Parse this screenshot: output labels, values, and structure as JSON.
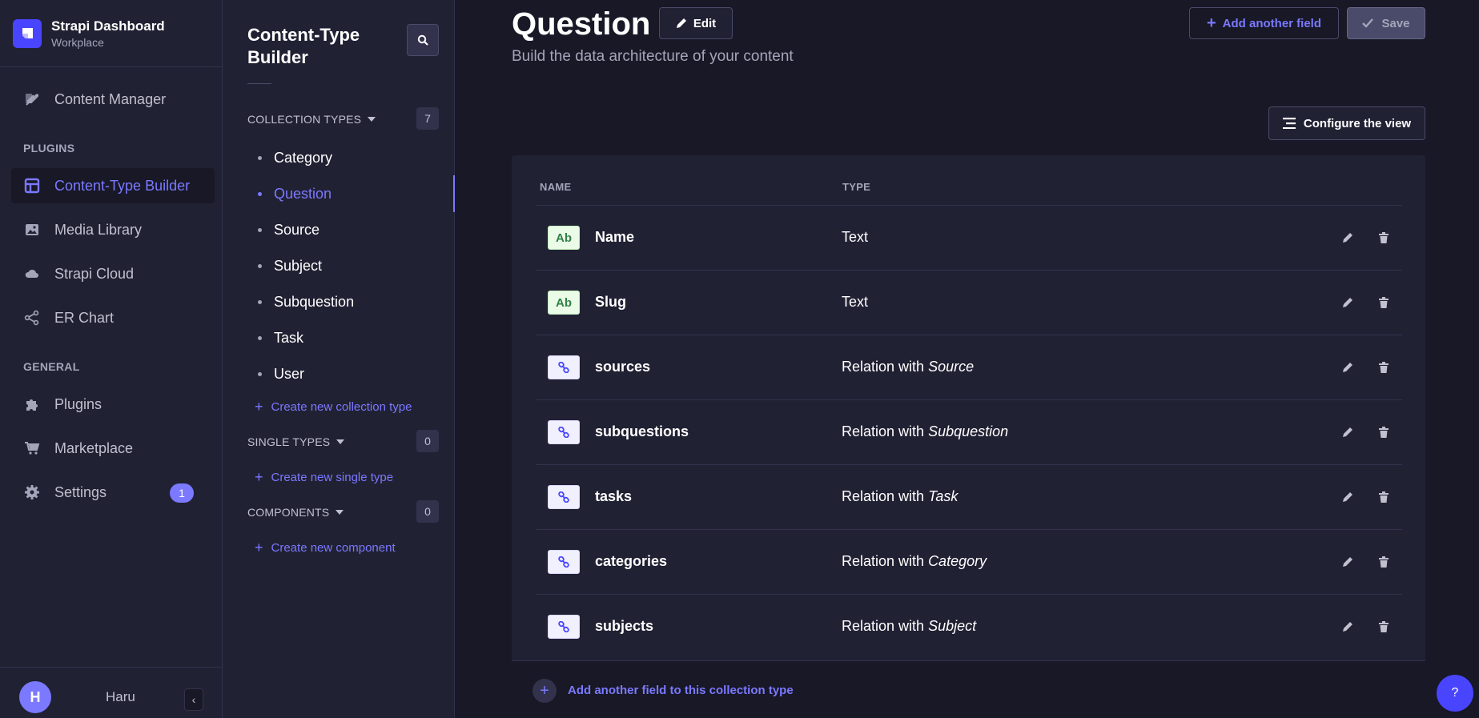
{
  "brand": {
    "title": "Strapi Dashboard",
    "subtitle": "Workplace"
  },
  "mainnav": {
    "items": [
      {
        "label": "Content Manager",
        "icon": "feather-icon"
      },
      {
        "label": "Content-Type Builder",
        "icon": "layout-icon",
        "active": true
      },
      {
        "label": "Media Library",
        "icon": "image-icon"
      },
      {
        "label": "Strapi Cloud",
        "icon": "cloud-icon"
      },
      {
        "label": "ER Chart",
        "icon": "share-icon"
      },
      {
        "label": "Plugins",
        "icon": "puzzle-icon"
      },
      {
        "label": "Marketplace",
        "icon": "cart-icon"
      },
      {
        "label": "Settings",
        "icon": "gear-icon",
        "badge": "1"
      }
    ],
    "sections": {
      "plugins": "PLUGINS",
      "general": "GENERAL"
    },
    "user": {
      "initial": "H",
      "name": "Haru"
    }
  },
  "subnav": {
    "title": "Content-Type Builder",
    "collection_types": {
      "label": "COLLECTION TYPES",
      "count": "7",
      "items": [
        "Category",
        "Question",
        "Source",
        "Subject",
        "Subquestion",
        "Task",
        "User"
      ],
      "active": "Question",
      "create_label": "Create new collection type"
    },
    "single_types": {
      "label": "SINGLE TYPES",
      "count": "0",
      "create_label": "Create new single type"
    },
    "components": {
      "label": "COMPONENTS",
      "count": "0",
      "create_label": "Create new component"
    }
  },
  "header": {
    "title": "Question",
    "edit_label": "Edit",
    "subtitle": "Build the data architecture of your content",
    "add_field_label": "Add another field",
    "save_label": "Save",
    "configure_label": "Configure the view"
  },
  "table": {
    "columns": {
      "name": "NAME",
      "type": "TYPE"
    },
    "rows": [
      {
        "name": "Name",
        "kind": "text",
        "icon_text": "Ab",
        "type_prefix": "Text",
        "type_target": ""
      },
      {
        "name": "Slug",
        "kind": "text",
        "icon_text": "Ab",
        "type_prefix": "Text",
        "type_target": ""
      },
      {
        "name": "sources",
        "kind": "relation",
        "icon_text": "",
        "type_prefix": "Relation with ",
        "type_target": "Source"
      },
      {
        "name": "subquestions",
        "kind": "relation",
        "icon_text": "",
        "type_prefix": "Relation with ",
        "type_target": "Subquestion"
      },
      {
        "name": "tasks",
        "kind": "relation",
        "icon_text": "",
        "type_prefix": "Relation with ",
        "type_target": "Task"
      },
      {
        "name": "categories",
        "kind": "relation",
        "icon_text": "",
        "type_prefix": "Relation with ",
        "type_target": "Category"
      },
      {
        "name": "subjects",
        "kind": "relation",
        "icon_text": "",
        "type_prefix": "Relation with ",
        "type_target": "Subject"
      }
    ],
    "footer_label": "Add another field to this collection type"
  },
  "help": {
    "label": "?"
  },
  "colors": {
    "accent": "#7b79ff",
    "primary": "#4945ff",
    "background": "#181826",
    "surface": "#212134"
  }
}
